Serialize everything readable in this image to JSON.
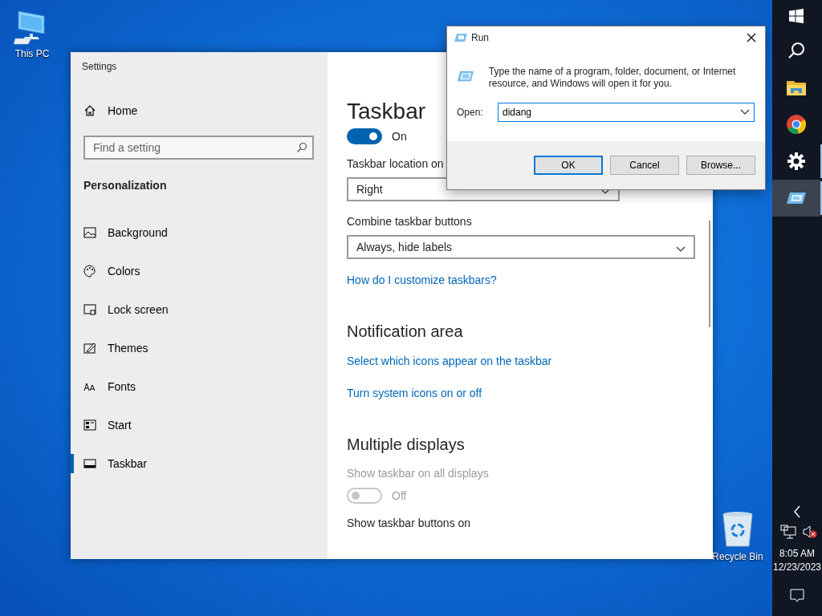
{
  "desktop_icons": [
    {
      "kind": "computer",
      "label": "This PC"
    },
    {
      "kind": "recycle_bin",
      "label": "Recycle Bin"
    }
  ],
  "settings": {
    "title": "Settings",
    "home": "Home",
    "search": {
      "placeholder": "Find a setting"
    },
    "section": "Personalization",
    "nav": [
      {
        "kind": "background",
        "label": "Background",
        "selected": false
      },
      {
        "kind": "colors",
        "label": "Colors",
        "selected": false
      },
      {
        "kind": "lock",
        "label": "Lock screen",
        "selected": false
      },
      {
        "kind": "themes",
        "label": "Themes",
        "selected": false
      },
      {
        "kind": "fonts",
        "label": "Fonts",
        "selected": false
      },
      {
        "kind": "start",
        "label": "Start",
        "selected": false
      },
      {
        "kind": "taskbar",
        "label": "Taskbar",
        "selected": true
      }
    ],
    "page": {
      "title": "Taskbar",
      "items": [
        {
          "kind": "toggle",
          "on": true,
          "disabled": false,
          "label": "On"
        },
        {
          "kind": "label",
          "text": "Taskbar location on",
          "disabled": false
        },
        {
          "kind": "dropdown",
          "value": "Right"
        },
        {
          "kind": "label",
          "text": "Combine taskbar buttons",
          "disabled": false
        },
        {
          "kind": "dropdown",
          "value": "Always, hide labels"
        },
        {
          "kind": "link",
          "text": "How do I customize taskbars?"
        },
        {
          "kind": "heading",
          "text": "Notification area"
        },
        {
          "kind": "link",
          "text": "Select which icons appear on the taskbar"
        },
        {
          "kind": "link",
          "text": "Turn system icons on or off"
        },
        {
          "kind": "heading",
          "text": "Multiple displays"
        },
        {
          "kind": "label",
          "text": "Show taskbar on all displays",
          "disabled": true
        },
        {
          "kind": "toggle",
          "on": false,
          "disabled": true,
          "label": "Off"
        },
        {
          "kind": "label",
          "text": "Show taskbar buttons on",
          "disabled": false
        }
      ]
    }
  },
  "run_dialog": {
    "title": "Run",
    "description": "Type the name of a program, folder, document, or Internet resource, and Windows will open it for you.",
    "open_label": "Open:",
    "value": "didang",
    "buttons": [
      {
        "label": "OK",
        "default": true
      },
      {
        "label": "Cancel",
        "default": false
      },
      {
        "label": "Browse...",
        "default": false
      }
    ]
  },
  "taskbar": {
    "apps": [
      {
        "kind": "start",
        "running": false,
        "selected": false
      },
      {
        "kind": "search",
        "running": false,
        "selected": false
      },
      {
        "kind": "explorer",
        "running": false,
        "selected": false
      },
      {
        "kind": "chrome",
        "running": false,
        "selected": false
      },
      {
        "kind": "settings",
        "running": true,
        "selected": false
      },
      {
        "kind": "run",
        "running": true,
        "selected": true
      }
    ],
    "clock": {
      "time": "8:05 AM",
      "date": "12/23/2023"
    }
  }
}
